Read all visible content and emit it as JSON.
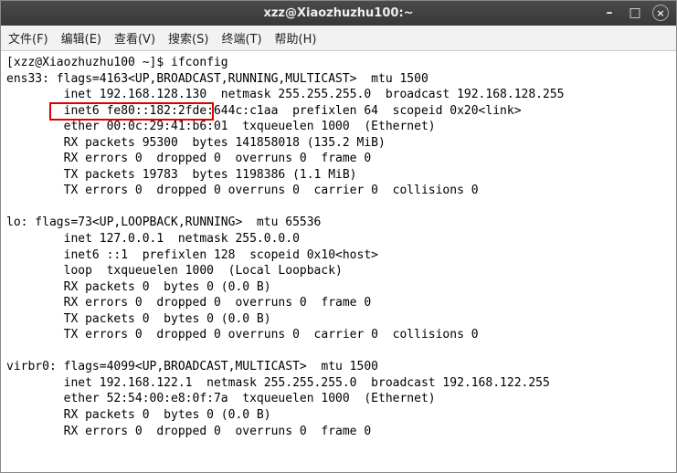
{
  "window": {
    "title": "xzz@Xiaozhuzhu100:~",
    "controls": {
      "minimize": "–",
      "maximize": "□",
      "close": "×"
    }
  },
  "menubar": {
    "file": "文件(F)",
    "edit": "编辑(E)",
    "view": "查看(V)",
    "search": "搜索(S)",
    "terminal": "终端(T)",
    "help": "帮助(H)"
  },
  "terminal": {
    "lines": [
      "[xzz@Xiaozhuzhu100 ~]$ ifconfig",
      "ens33: flags=4163<UP,BROADCAST,RUNNING,MULTICAST>  mtu 1500",
      "        inet 192.168.128.130  netmask 255.255.255.0  broadcast 192.168.128.255",
      "        inet6 fe80::182:2fde:644c:c1aa  prefixlen 64  scopeid 0x20<link>",
      "        ether 00:0c:29:41:b6:01  txqueuelen 1000  (Ethernet)",
      "        RX packets 95300  bytes 141858018 (135.2 MiB)",
      "        RX errors 0  dropped 0  overruns 0  frame 0",
      "        TX packets 19783  bytes 1198386 (1.1 MiB)",
      "        TX errors 0  dropped 0 overruns 0  carrier 0  collisions 0",
      "",
      "lo: flags=73<UP,LOOPBACK,RUNNING>  mtu 65536",
      "        inet 127.0.0.1  netmask 255.0.0.0",
      "        inet6 ::1  prefixlen 128  scopeid 0x10<host>",
      "        loop  txqueuelen 1000  (Local Loopback)",
      "        RX packets 0  bytes 0 (0.0 B)",
      "        RX errors 0  dropped 0  overruns 0  frame 0",
      "        TX packets 0  bytes 0 (0.0 B)",
      "        TX errors 0  dropped 0 overruns 0  carrier 0  collisions 0",
      "",
      "virbr0: flags=4099<UP,BROADCAST,MULTICAST>  mtu 1500",
      "        inet 192.168.122.1  netmask 255.255.255.0  broadcast 192.168.122.255",
      "        ether 52:54:00:e8:0f:7a  txqueuelen 1000  (Ethernet)",
      "        RX packets 0  bytes 0 (0.0 B)",
      "        RX errors 0  dropped 0  overruns 0  frame 0"
    ]
  },
  "highlight": {
    "top": "56",
    "left": "53",
    "width": "180",
    "height": "20"
  }
}
